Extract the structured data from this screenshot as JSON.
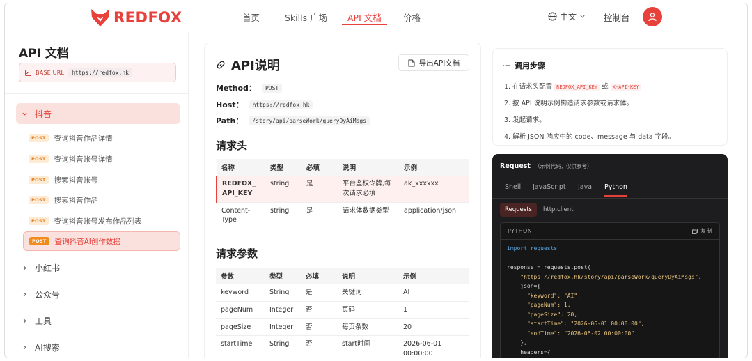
{
  "brand": {
    "name": "REDFOX",
    "color": "#e8403a"
  },
  "nav": {
    "items": [
      "首页",
      "Skills 广场",
      "API 文档",
      "价格"
    ],
    "active_index": 2,
    "language": "中文",
    "console": "控制台"
  },
  "sidebar": {
    "title": "API 文档",
    "base_url_label": "BASE URL",
    "base_url": "https://redfox.hk",
    "categories": [
      {
        "label": "抖音",
        "open": true
      },
      {
        "label": "小红书"
      },
      {
        "label": "公众号"
      },
      {
        "label": "工具"
      },
      {
        "label": "AI搜索"
      }
    ],
    "douyin_items": [
      {
        "method": "POST",
        "label": "查询抖音作品详情"
      },
      {
        "method": "POST",
        "label": "查询抖音账号详情"
      },
      {
        "method": "POST",
        "label": "搜索抖音账号"
      },
      {
        "method": "POST",
        "label": "搜索抖音作品"
      },
      {
        "method": "POST",
        "label": "查询抖音账号发布作品列表"
      },
      {
        "method": "POST",
        "label": "查询抖音AI创作数据",
        "active": true
      }
    ]
  },
  "main": {
    "title": "API说明",
    "export_label": "导出API文档",
    "method_label": "Method：",
    "method": "POST",
    "host_label": "Host：",
    "host": "https://redfox.hk",
    "path_label": "Path：",
    "path": "/story/api/parseWork/queryDyAiMsgs",
    "headers_title": "请求头",
    "params_title": "请求参数",
    "columns": [
      "名称",
      "类型",
      "必填",
      "说明",
      "示例"
    ],
    "param_columns": [
      "参数",
      "类型",
      "必填",
      "说明",
      "示例"
    ],
    "headers": [
      {
        "name": "REDFOX_API_KEY",
        "type": "string",
        "required": "是",
        "desc": "平台鉴权令牌,每次请求必填",
        "example": "ak_xxxxxx"
      },
      {
        "name": "Content-Type",
        "type": "string",
        "required": "是",
        "desc": "请求体数据类型",
        "example": "application/json"
      }
    ],
    "params": [
      {
        "name": "keyword",
        "type": "String",
        "required": "是",
        "desc": "关键词",
        "example": "AI"
      },
      {
        "name": "pageNum",
        "type": "Integer",
        "required": "否",
        "desc": "页码",
        "example": "1"
      },
      {
        "name": "pageSize",
        "type": "Integer",
        "required": "否",
        "desc": "每页条数",
        "example": "20"
      },
      {
        "name": "startTime",
        "type": "String",
        "required": "否",
        "desc": "start时间",
        "example": "2026-06-01 00:00:00"
      }
    ]
  },
  "steps": {
    "title": "调用步骤",
    "items": [
      {
        "pre": "1. 在请求头配置 ",
        "k1": "REDFOX_API_KEY",
        "mid": " 或 ",
        "k2": "X-API-KEY"
      },
      {
        "text": "2. 按 API 说明示例构造请求参数或请求体。"
      },
      {
        "text": "3. 发起请求。"
      },
      {
        "text": "4. 解析 JSON 响应中的 code、message 与 data 字段。"
      }
    ]
  },
  "code": {
    "title": "Request",
    "subtitle": "（示例代码，仅供参考）",
    "tabs": [
      "Shell",
      "JavaScript",
      "Java",
      "Python"
    ],
    "active_tab": "Python",
    "libs": [
      "Requests",
      "http.client"
    ],
    "active_lib": "Requests",
    "lang_label": "PYTHON",
    "copy_label": "复制",
    "lines": [
      "import requests",
      "",
      "response = requests.post(",
      "    \"https://redfox.hk/story/api/parseWork/queryDyAiMsgs\",",
      "    json={",
      "      \"keyword\": \"AI\",",
      "      \"pageNum\": 1,",
      "      \"pageSize\": 20,",
      "      \"startTime\": \"2026-06-01 00:00:00\",",
      "      \"endTime\": \"2026-06-02 00:00:00\"",
      "    },",
      "    headers={"
    ]
  }
}
